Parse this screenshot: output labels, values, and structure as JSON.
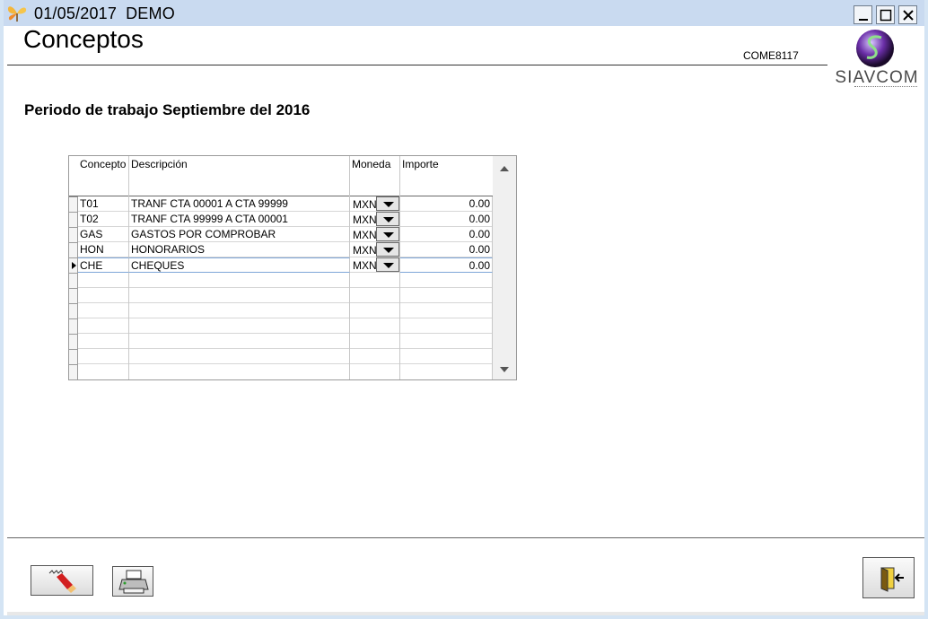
{
  "window": {
    "date": "01/05/2017",
    "company": "DEMO"
  },
  "page": {
    "title": "Conceptos",
    "form_code": "COME8117",
    "period": "Periodo de trabajo Septiembre del 2016"
  },
  "logo": {
    "text": "SIAVCOM"
  },
  "grid": {
    "headers": {
      "concepto": "Concepto",
      "descripcion": "Descripción",
      "moneda": "Moneda",
      "importe": "Importe"
    },
    "rows": [
      {
        "concepto": "T01",
        "descripcion": "TRANF CTA  00001 A CTA 99999",
        "moneda": "MXN",
        "importe": "0.00"
      },
      {
        "concepto": "T02",
        "descripcion": "TRANF CTA  99999 A CTA  00001",
        "moneda": "MXN",
        "importe": "0.00"
      },
      {
        "concepto": "GAS",
        "descripcion": "GASTOS POR COMPROBAR",
        "moneda": "MXN",
        "importe": "0.00"
      },
      {
        "concepto": "HON",
        "descripcion": "HONORARIOS",
        "moneda": "MXN",
        "importe": "0.00"
      },
      {
        "concepto": "CHE",
        "descripcion": "CHEQUES",
        "moneda": "MXN",
        "importe": "0.00"
      }
    ]
  },
  "icons": {
    "app": "butterfly-icon",
    "clean": "eraser-icon",
    "print": "printer-icon",
    "exit": "exit-door-icon"
  },
  "colors": {
    "titlebar": "#c9daf0",
    "selection": "#7ea6d8"
  }
}
